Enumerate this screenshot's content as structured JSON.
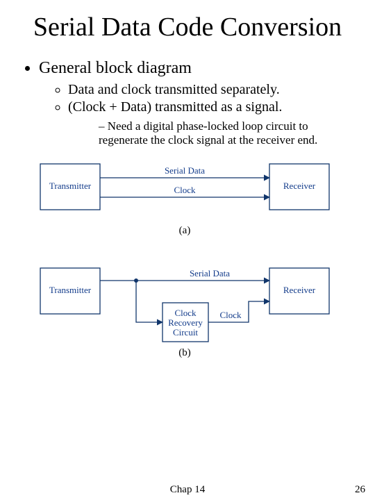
{
  "title": "Serial Data Code Conversion",
  "bullets": {
    "l1": "General block diagram",
    "l2a": "Data and clock transmitted separately.",
    "l2b": "(Clock + Data) transmitted as a signal.",
    "l3": "Need a digital phase-locked loop circuit to regenerate the clock signal at the receiver end."
  },
  "diagram": {
    "transmitter": "Transmitter",
    "receiver": "Receiver",
    "serial_data": "Serial Data",
    "clock": "Clock",
    "clock_recovery_l1": "Clock",
    "clock_recovery_l2": "Recovery",
    "clock_recovery_l3": "Circuit",
    "sub_a": "(a)",
    "sub_b": "(b)"
  },
  "footer": {
    "center": "Chap 14",
    "right": "26"
  }
}
